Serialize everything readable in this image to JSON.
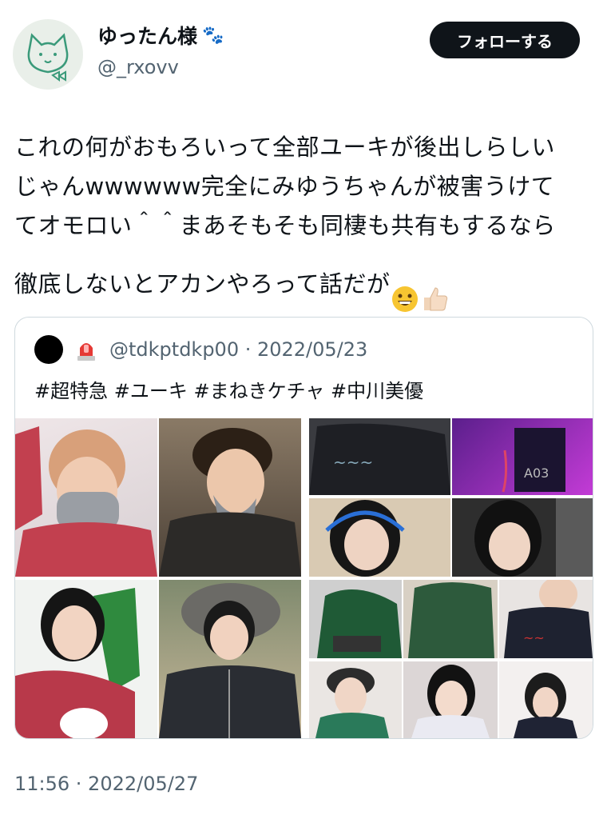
{
  "user": {
    "display_name": "ゆったん様",
    "name_emoji": "🐾",
    "handle": "@_rxovv"
  },
  "follow_button": {
    "label": "フォローする"
  },
  "tweet": {
    "text": "これの何がおもろいって全部ユーキが後出しらしい\nじゃんwwwwww完全にみゆうちゃんが被害うけて\nてオモロい＾＾まあそもそも同棲も共有もするなら\n徹底しないとアカンやろって話だが",
    "trailing_emojis": [
      "grinning-face",
      "thumbs-up-light-skin"
    ],
    "timestamp": "11:56 · 2022/05/27"
  },
  "quoted_tweet": {
    "avatar_icon": "black-circle-avatar",
    "badge_icon": "police-light-icon",
    "handle_date": "@tdkptdkp00 · 2022/05/23",
    "hashtags": "#超特急 #ユーキ #まねきケチャ #中川美優"
  },
  "colors": {
    "text": "#0f1419",
    "muted": "#536471",
    "border": "#cfd9de",
    "button_bg": "#0f1419"
  }
}
